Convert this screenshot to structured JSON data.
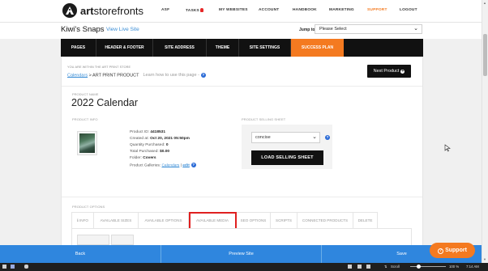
{
  "brand": {
    "name_bold": "art",
    "name_rest": "storefronts"
  },
  "top_nav": {
    "items": [
      {
        "label": "ASF"
      },
      {
        "label": "TASKS"
      },
      {
        "label": "MY WEBSITES"
      },
      {
        "label": "ACCOUNT"
      },
      {
        "label": "HANDBOOK"
      },
      {
        "label": "MARKETING"
      },
      {
        "label": "SUPPORT",
        "active": true
      },
      {
        "label": "LOGOUT"
      }
    ]
  },
  "site": {
    "title": "Kiwi's Snaps",
    "view_live": "View Live Site",
    "jump_label": "Jump to:",
    "jump_value": "Please Select"
  },
  "main_tabs": [
    {
      "label": "PAGES"
    },
    {
      "label": "HEADER & FOOTER"
    },
    {
      "label": "SITE ADDRESS"
    },
    {
      "label": "THEME"
    },
    {
      "label": "SITE SETTINGS"
    },
    {
      "label": "SUCCESS PLAN",
      "active": true
    }
  ],
  "breadcrumb": {
    "note": "YOU ARE WITHIN THE ART PRINT STORE",
    "link": "Calendars",
    "separator": " > ",
    "current": "ART PRINT PRODUCT",
    "help": "Learn how to use this page -"
  },
  "next_product": "Next Product",
  "product_name": {
    "label": "PRODUCT NAME",
    "value": "2022 Calendar"
  },
  "product_info": {
    "label": "PRODUCT INFO",
    "lines": [
      {
        "key": "Product ID:",
        "value": "4418531"
      },
      {
        "key": "Created at:",
        "value": "Oct 20, 2021 05:50pm"
      },
      {
        "key": "Quantity Purchased:",
        "value": "0"
      },
      {
        "key": "Total Purchased:",
        "value": "$0.00"
      },
      {
        "key": "Folder:",
        "value": "Covers"
      }
    ],
    "galleries_key": "Product Galleries:",
    "galleries_link": "Calendars",
    "galleries_sep": " | ",
    "edit": "edit"
  },
  "selling_sheet": {
    "label": "PRODUCT SELLING SHEET",
    "select_value": "concise",
    "load_button": "LOAD SELLING SHEET"
  },
  "product_options": {
    "label": "PRODUCT OPTIONS",
    "tabs": [
      {
        "label": "INFO",
        "prefix": "ℹ"
      },
      {
        "label": "AVAILABLE SIZES"
      },
      {
        "label": "AVAILABLE OPTIONS"
      },
      {
        "label": "AVAILABLE MEDIA",
        "highlighted": true
      },
      {
        "label": "SEO OPTIONS"
      },
      {
        "label": "SCRIPTS"
      },
      {
        "label": "CONNECTED PRODUCTS"
      },
      {
        "label": "DELETE"
      }
    ]
  },
  "bottom_bar": {
    "back": "Back",
    "preview": "Preview Site",
    "save": "Save",
    "support": "Support"
  },
  "taskbar": {
    "scroll_label": "Scroll",
    "zoom": "100 %",
    "time": "7:14 AM"
  },
  "colors": {
    "accent_orange": "#f47a20",
    "action_blue": "#2f86de",
    "link_blue": "#3d8fd6",
    "dark": "#111111",
    "highlight_red": "#e02020"
  },
  "icons": [
    "logo-icon",
    "bell-icon",
    "chevron-down-icon",
    "help-icon",
    "plus-circle-icon",
    "info-icon",
    "support-icon",
    "cursor-icon"
  ]
}
